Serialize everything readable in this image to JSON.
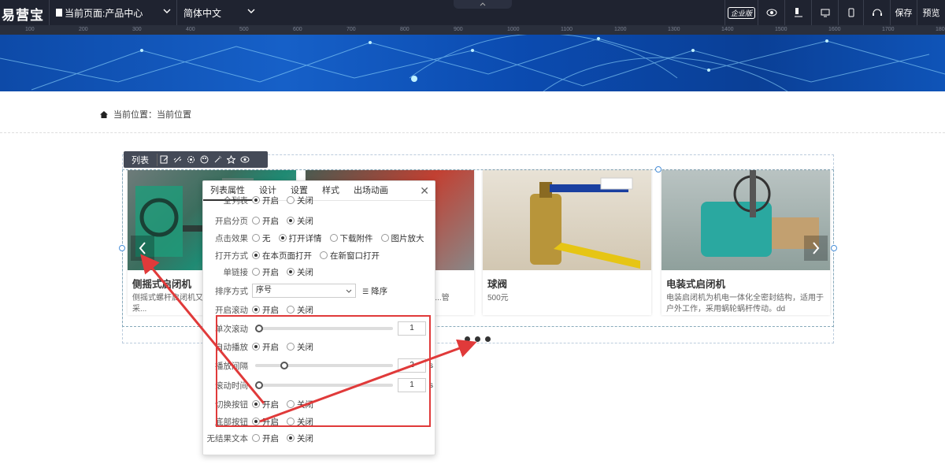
{
  "topbar": {
    "logo": "易营宝",
    "page_select": "当前页面:产品中心",
    "lang_select": "简体中文",
    "edition": "企业版",
    "save": "保存",
    "preview": "预览"
  },
  "ruler": {
    "ticks": [
      "100",
      "200",
      "300",
      "400",
      "500",
      "600",
      "700",
      "800",
      "900",
      "1000",
      "1100",
      "1200",
      "1300",
      "1400",
      "1500",
      "1600",
      "1700",
      "1800"
    ]
  },
  "breadcrumb": {
    "label": "当前位置：",
    "value": "当前位置"
  },
  "list_toolbar": {
    "label": "列表",
    "icons": [
      "edit-icon",
      "link-icon",
      "gear-icon",
      "palette-icon",
      "magic-icon",
      "star-icon",
      "eye-icon"
    ]
  },
  "products": [
    {
      "title": "侧摇式启闭机",
      "desc": "侧摇式螺杆启闭机又称...式螺杆启闭机是一种采..."
    },
    {
      "title": "",
      "desc": "...的一种启...管的，..."
    },
    {
      "title": "球阀",
      "desc": "500元"
    },
    {
      "title": "电装式启闭机",
      "desc": "电装启闭机为机电一体化全密封结构，适用于户外工作，采用蜗轮蜗杆传动。dd"
    }
  ],
  "panel": {
    "tabs": [
      "列表属性",
      "设计",
      "设置",
      "样式",
      "出场动画"
    ],
    "active_tab": 0,
    "rows": {
      "show_all": {
        "label": "全列表",
        "options": [
          "开启",
          "关闭"
        ],
        "selected": 0
      },
      "pagination": {
        "label": "开启分页",
        "options": [
          "开启",
          "关闭"
        ],
        "selected": 1
      },
      "click_effect": {
        "label": "点击效果",
        "options": [
          "无",
          "打开详情",
          "下载附件",
          "图片放大"
        ],
        "selected": 1
      },
      "open_mode": {
        "label": "打开方式",
        "options": [
          "在本页面打开",
          "在新窗口打开"
        ],
        "selected": 0
      },
      "single_link": {
        "label": "单链接",
        "options": [
          "开启",
          "关闭"
        ],
        "selected": 1
      },
      "sort": {
        "label": "排序方式",
        "value": "序号",
        "order": "降序"
      },
      "scroll": {
        "label": "开启滚动",
        "options": [
          "开启",
          "关闭"
        ],
        "selected": 0
      },
      "single_scroll": {
        "label": "单次滚动",
        "value": "1"
      },
      "autoplay": {
        "label": "自动播放",
        "options": [
          "开启",
          "关闭"
        ],
        "selected": 0
      },
      "interval": {
        "label": "播放间隔",
        "value": "2",
        "unit": "s"
      },
      "scroll_time": {
        "label": "滚动时间",
        "value": "1",
        "unit": "s"
      },
      "switch_btn": {
        "label": "切换按钮",
        "options": [
          "开启",
          "关闭"
        ],
        "selected": 0
      },
      "bottom_btn": {
        "label": "底部按钮",
        "options": [
          "开启",
          "关闭"
        ],
        "selected": 0
      },
      "no_result": {
        "label": "无结果文本",
        "options": [
          "开启",
          "关闭"
        ],
        "selected": 1
      }
    }
  }
}
